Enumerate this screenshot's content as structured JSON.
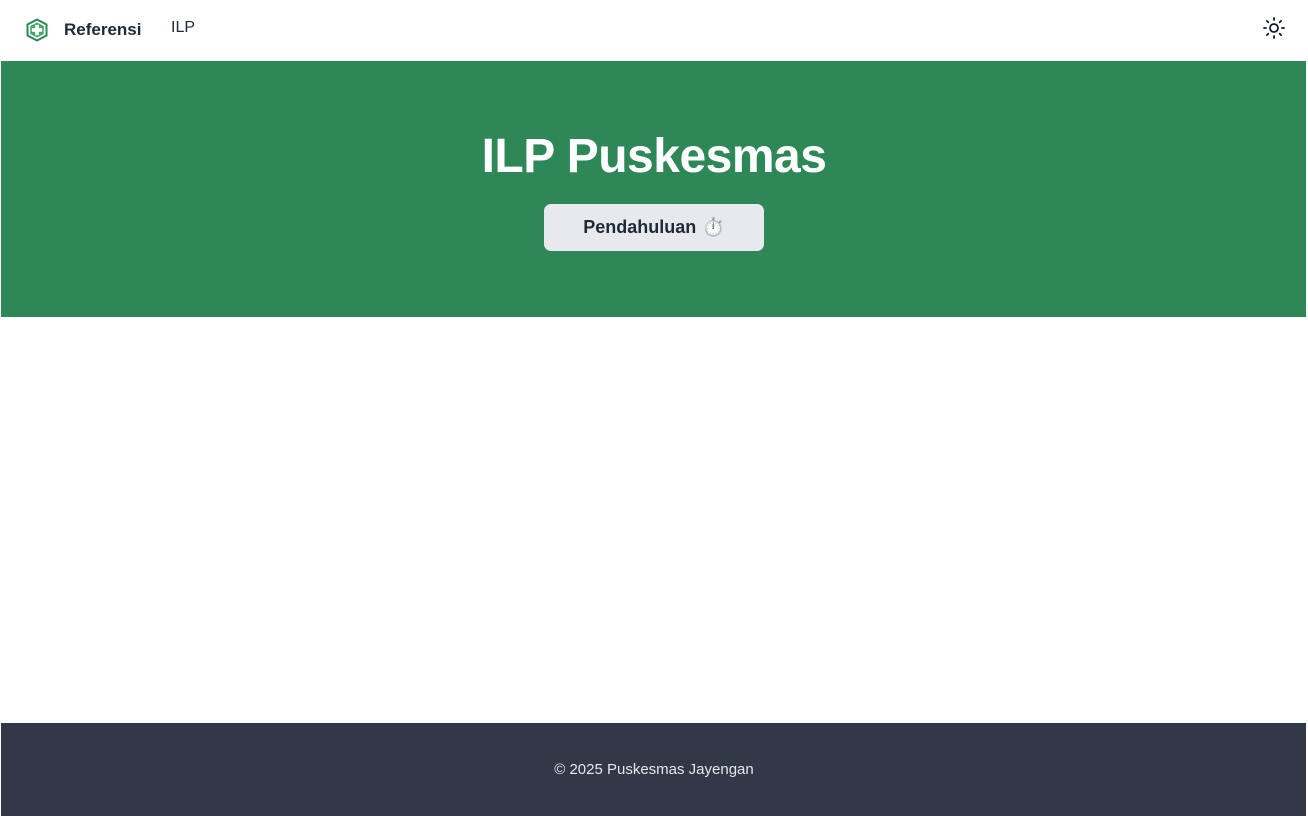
{
  "navbar": {
    "brand_title": "Referensi",
    "logo_icon": "health-cross-logo-icon",
    "links": [
      {
        "label": "ILP"
      }
    ],
    "theme_toggle_icon": "sun-icon"
  },
  "hero": {
    "title": "ILP Puskesmas",
    "button_label": "Pendahuluan",
    "button_emoji": "⏱️",
    "background_color": "#2e8757"
  },
  "footer": {
    "text": "© 2025 Puskesmas Jayengan",
    "background_color": "#313847"
  }
}
